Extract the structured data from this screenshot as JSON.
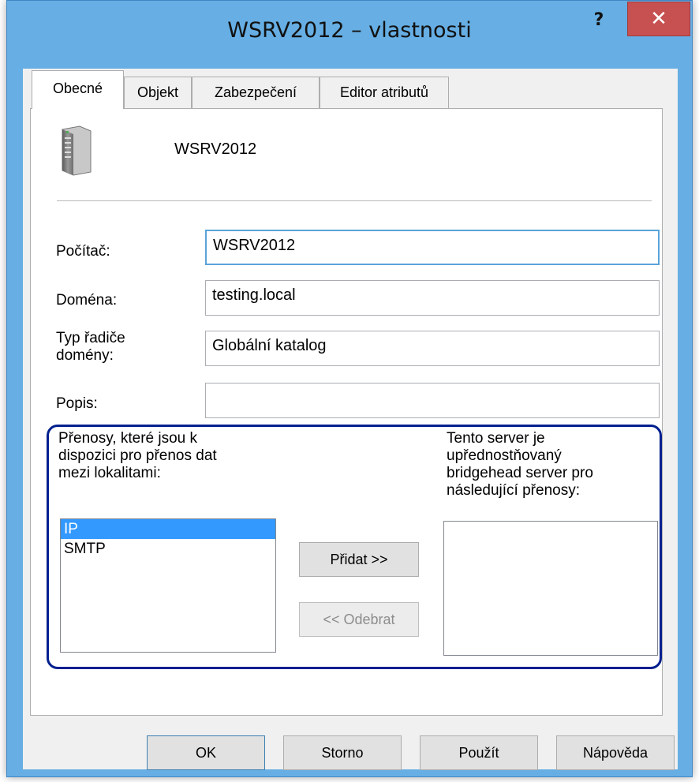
{
  "window": {
    "title": "WSRV2012 – vlastnosti",
    "help_glyph": "?",
    "close_glyph": "✕"
  },
  "tabs": [
    {
      "label": "Obecné"
    },
    {
      "label": "Objekt"
    },
    {
      "label": "Zabezpečení"
    },
    {
      "label": "Editor atributů"
    }
  ],
  "general": {
    "hostname": "WSRV2012",
    "computer_label": "Počítač:",
    "computer_value": "WSRV2012",
    "domain_label": "Doména:",
    "domain_value": "testing.local",
    "dc_type_label_line1": "Typ řadiče",
    "dc_type_label_line2": "domény:",
    "dc_type_value": "Globální katalog",
    "description_label": "Popis:",
    "description_value": ""
  },
  "transports": {
    "available_label_line1": "Přenosy, které jsou k",
    "available_label_line2": "dispozici pro přenos dat",
    "available_label_line3": "mezi lokalitami:",
    "preferred_label_line1": "Tento server je",
    "preferred_label_line2": "upřednostňovaný",
    "preferred_label_line3": "bridgehead server pro",
    "preferred_label_line4": "následující přenosy:",
    "available_items": [
      "IP",
      "SMTP"
    ],
    "add_button": "Přidat >>",
    "remove_button": "<< Odebrat"
  },
  "footer": {
    "ok": "OK",
    "cancel": "Storno",
    "apply": "Použít",
    "help": "Nápověda"
  },
  "colors": {
    "frame": "#66aee3",
    "close_button": "#c75050",
    "group_highlight": "#001f8f",
    "selection": "#3399ff"
  }
}
